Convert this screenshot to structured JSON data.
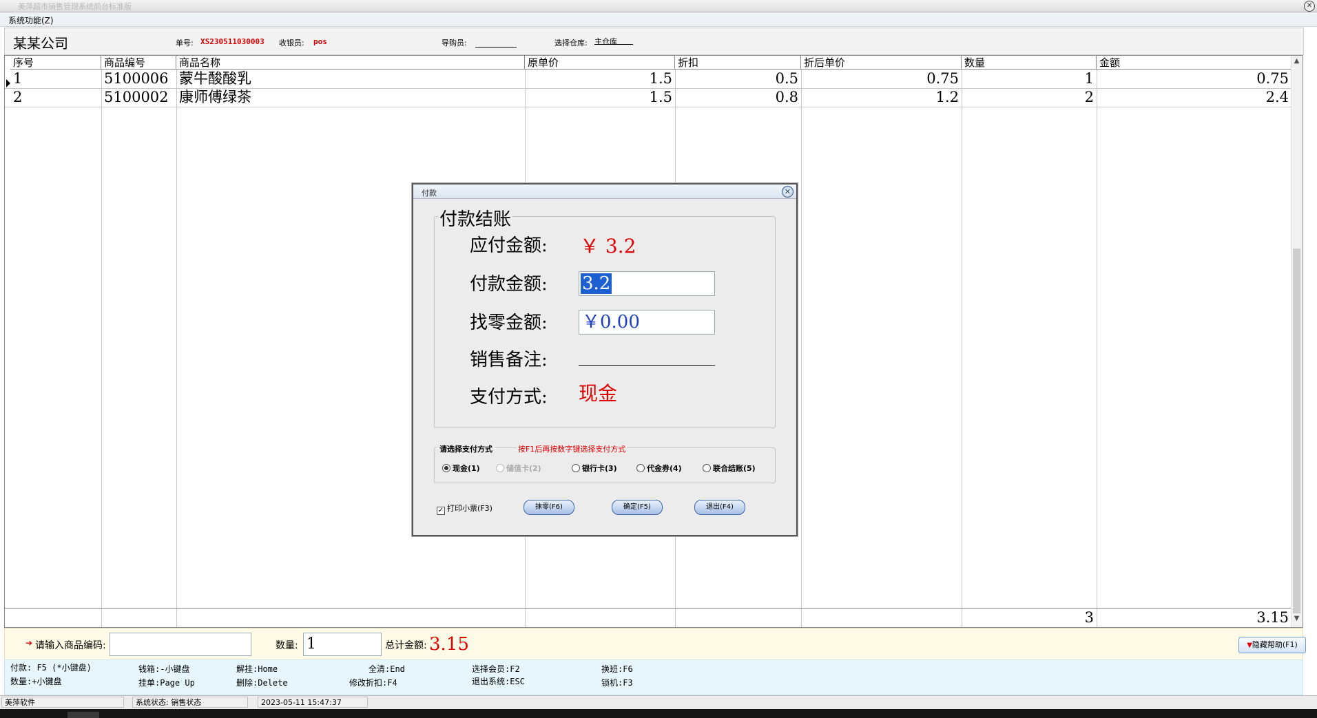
{
  "window": {
    "title": "美萍超市销售管理系统前台标准版",
    "close_glyph": "✕"
  },
  "menu": {
    "items": [
      "系统功能(Z)"
    ]
  },
  "header": {
    "company": "某某公司",
    "order_label": "单号:",
    "order_value": "XS230511030003",
    "cashier_label": "收银员:",
    "cashier_value": "pos",
    "guide_label": "导购员:",
    "guide_value": "",
    "warehouse_label": "选择仓库:",
    "warehouse_value": "主仓库"
  },
  "table": {
    "columns": [
      "序号",
      "商品编号",
      "商品名称",
      "原单价",
      "折扣",
      "折后单价",
      "数量",
      "金额"
    ],
    "rows": [
      [
        "1",
        "5100006",
        "蒙牛酸酸乳",
        "1.5",
        "0.5",
        "0.75",
        "1",
        "0.75"
      ],
      [
        "2",
        "5100002",
        "康师傅绿茶",
        "1.5",
        "0.8",
        "1.2",
        "2",
        "2.4"
      ]
    ],
    "current_row": 2,
    "footer": {
      "quantity_total": "3",
      "amount_total": "3.15"
    }
  },
  "dialog": {
    "title": "付款",
    "close_glyph": "✕",
    "group_title": "付款结账",
    "due_label": "应付金额:",
    "due_value": "￥ 3.2",
    "pay_label": "付款金额:",
    "pay_value": "3.2",
    "change_label": "找零金额:",
    "change_value": "￥0.00",
    "remark_label": "销售备注:",
    "method_label": "支付方式:",
    "method_value": "现金",
    "method_group_title": "请选择支付方式",
    "method_group_hint": "按F1后再按数字键选择支付方式",
    "methods": [
      {
        "label": "现金(1)",
        "selected": true,
        "enabled": true
      },
      {
        "label": "储值卡(2)",
        "selected": false,
        "enabled": false
      },
      {
        "label": "银行卡(3)",
        "selected": false,
        "enabled": true
      },
      {
        "label": "代金券(4)",
        "selected": false,
        "enabled": true
      },
      {
        "label": "联合结账(5)",
        "selected": false,
        "enabled": true
      }
    ],
    "print_receipt_label": "打印小票(F3)",
    "print_receipt_checked": true,
    "buttons": {
      "round": "抹零(F6)",
      "confirm": "确定(F5)",
      "exit": "退出(F4)"
    }
  },
  "inputbar": {
    "code_label": "请输入商品编码:",
    "code_value": "",
    "qty_label": "数量:",
    "qty_value": "1",
    "total_label": "总计金额:",
    "total_value": "3.15",
    "hide_help": "隐藏帮助(F1)"
  },
  "shortcuts": [
    "付款: F5 (*小键盘)",
    "数量:+小键盘",
    "钱箱:-小键盘",
    "挂单:Page Up",
    "解挂:Home",
    "删除:Delete",
    "全清:End",
    "修改折扣:F4",
    "选择会员:F2",
    "退出系统:ESC",
    "换班:F6",
    "锁机:F3"
  ],
  "status": {
    "app": "美萍软件",
    "state": "系统状态: 销售状态",
    "datetime": "2023-05-11 15:47:37"
  },
  "colors": {
    "accent_red": "#e00000",
    "selection_blue": "#1d5fd0",
    "change_blue": "#1d3fc8"
  }
}
